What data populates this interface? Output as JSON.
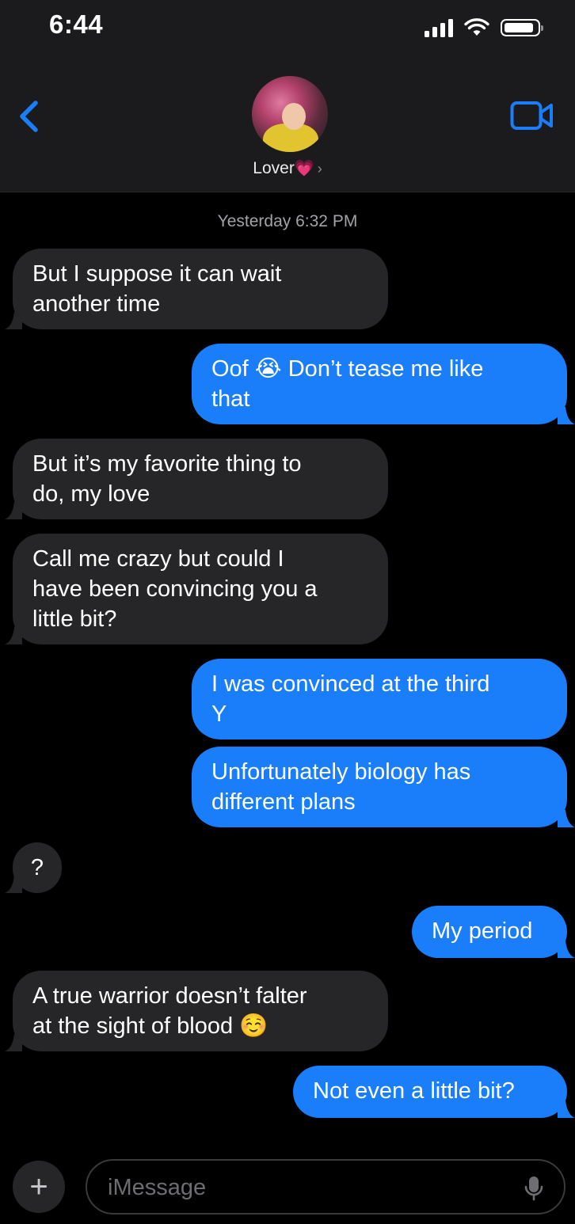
{
  "status_bar": {
    "time": "6:44"
  },
  "header": {
    "contact_name": "Lover",
    "contact_emoji": "💗",
    "chevron": "›",
    "back_icon": "chevron-left-icon",
    "video_icon": "video-camera-icon"
  },
  "conversation": {
    "timestamp": "Yesterday 6:32 PM",
    "messages": [
      {
        "direction": "incoming",
        "lines": [
          "But I suppose it can wait",
          "another time"
        ]
      },
      {
        "direction": "outgoing",
        "lines": [
          "Oof 😭 Don’t tease me like",
          "that"
        ]
      },
      {
        "direction": "incoming",
        "lines": [
          "But it’s my favorite thing to",
          "do, my love"
        ]
      },
      {
        "direction": "incoming",
        "lines": [
          "Call me crazy but could I",
          "have been convincing you a",
          "little bit?"
        ]
      },
      {
        "direction": "outgoing",
        "lines": [
          "I was convinced at the third",
          "Y"
        ]
      },
      {
        "direction": "outgoing",
        "lines": [
          "Unfortunately biology has",
          "different plans"
        ]
      },
      {
        "direction": "incoming",
        "lines": [
          "?"
        ]
      },
      {
        "direction": "outgoing",
        "lines": [
          "My period"
        ]
      },
      {
        "direction": "incoming",
        "lines": [
          "A true warrior doesn’t falter",
          "at the sight of blood ☺️"
        ]
      },
      {
        "direction": "outgoing",
        "lines": [
          "Not even a little bit?"
        ]
      }
    ]
  },
  "composer": {
    "plus_label": "+",
    "placeholder": "iMessage",
    "mic_icon": "microphone-icon"
  },
  "colors": {
    "outgoing_bubble": "#1a7efa",
    "incoming_bubble": "#262628",
    "accent": "#1a7efa"
  }
}
